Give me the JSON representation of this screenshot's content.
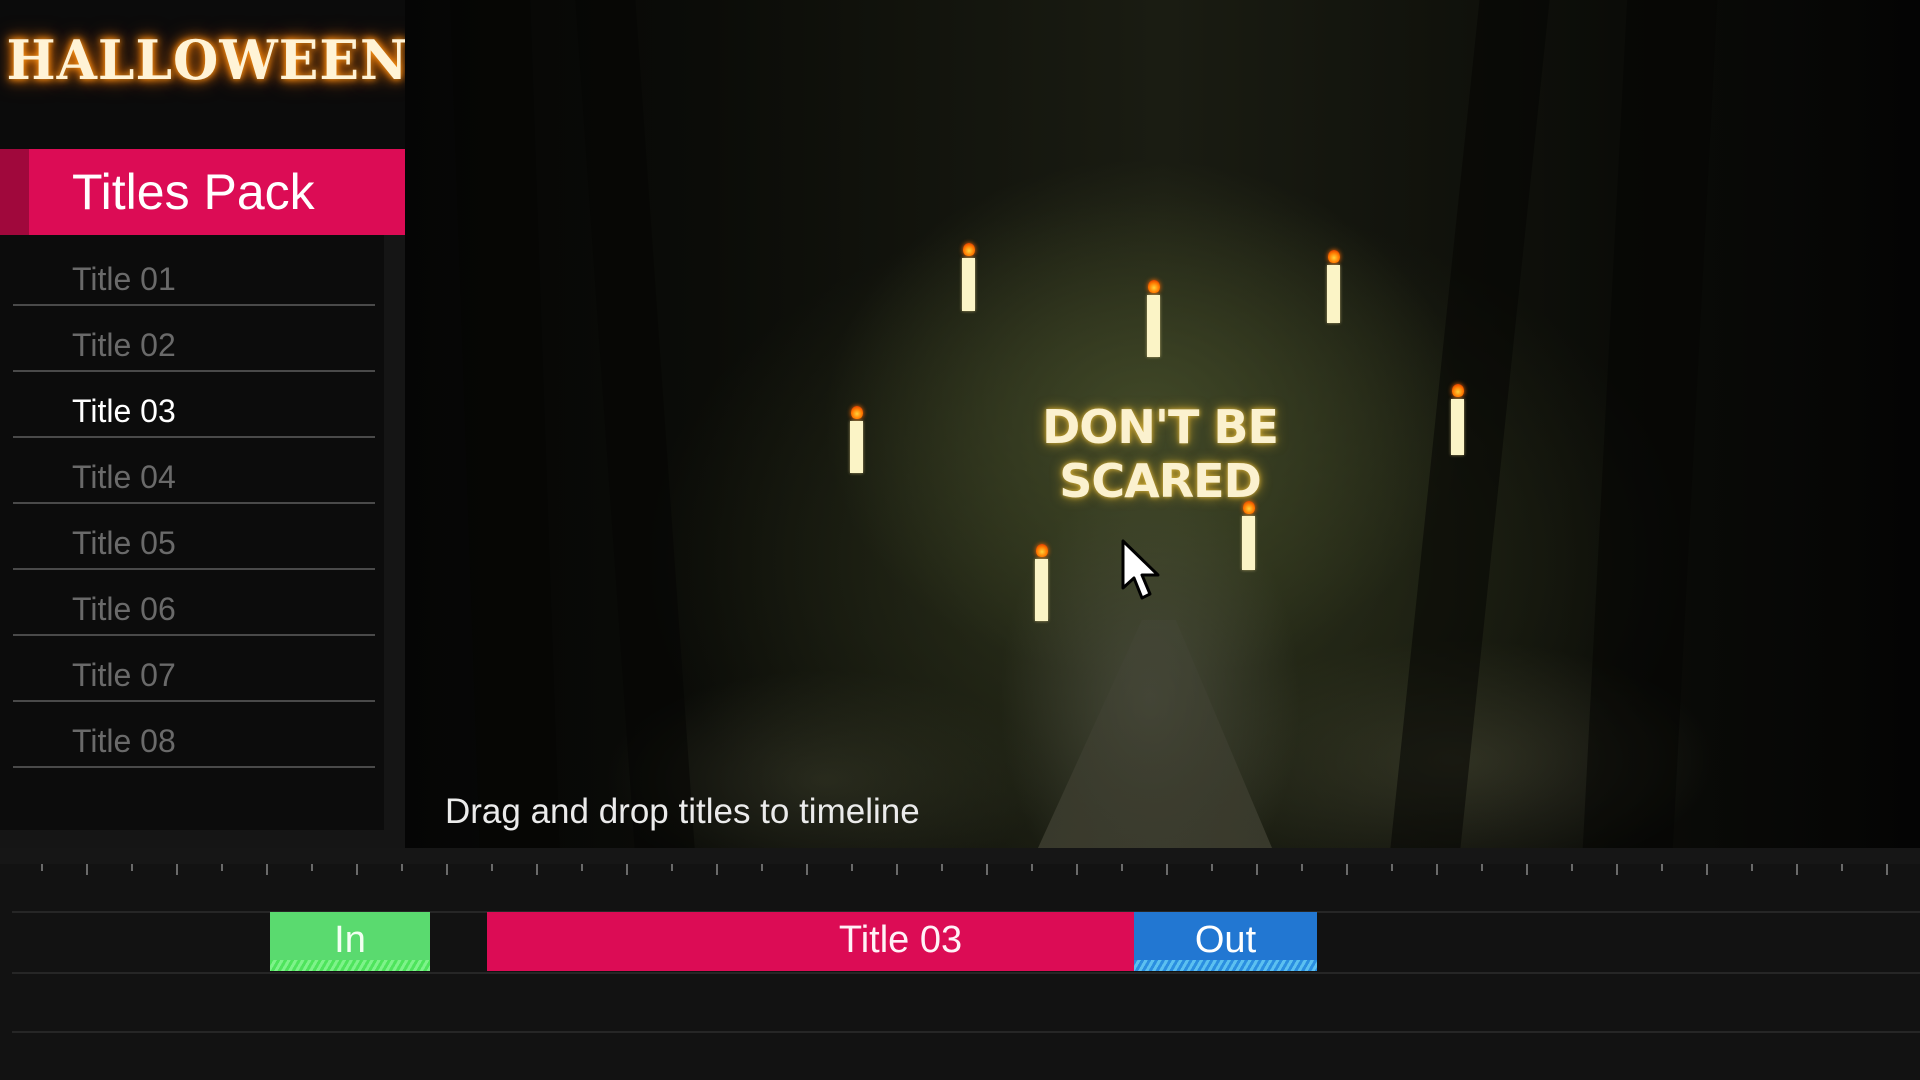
{
  "sidebar": {
    "logo": "HALLOWEEN",
    "pack_title": "Titles Pack",
    "items": [
      {
        "label": "Title 01",
        "active": false
      },
      {
        "label": "Title 02",
        "active": false
      },
      {
        "label": "Title 03",
        "active": true
      },
      {
        "label": "Title 04",
        "active": false
      },
      {
        "label": "Title 05",
        "active": false
      },
      {
        "label": "Title 06",
        "active": false
      },
      {
        "label": "Title 07",
        "active": false
      },
      {
        "label": "Title 08",
        "active": false
      }
    ]
  },
  "preview": {
    "headline": "DON'T BE SCARED",
    "hint": "Drag and drop titles to timeline",
    "icons": {
      "cursor": "mouse-pointer-icon",
      "candle": "candle-icon"
    }
  },
  "timeline": {
    "clips": [
      {
        "label": "In",
        "color": "#5ada6f"
      },
      {
        "label": "Title 03",
        "color": "#dc0c55"
      },
      {
        "label": "Out",
        "color": "#2277d2"
      }
    ]
  },
  "colors": {
    "accent": "#dc0c55",
    "accent_dark": "#a0083c",
    "in_green": "#5ada6f",
    "out_blue": "#2277d2"
  }
}
